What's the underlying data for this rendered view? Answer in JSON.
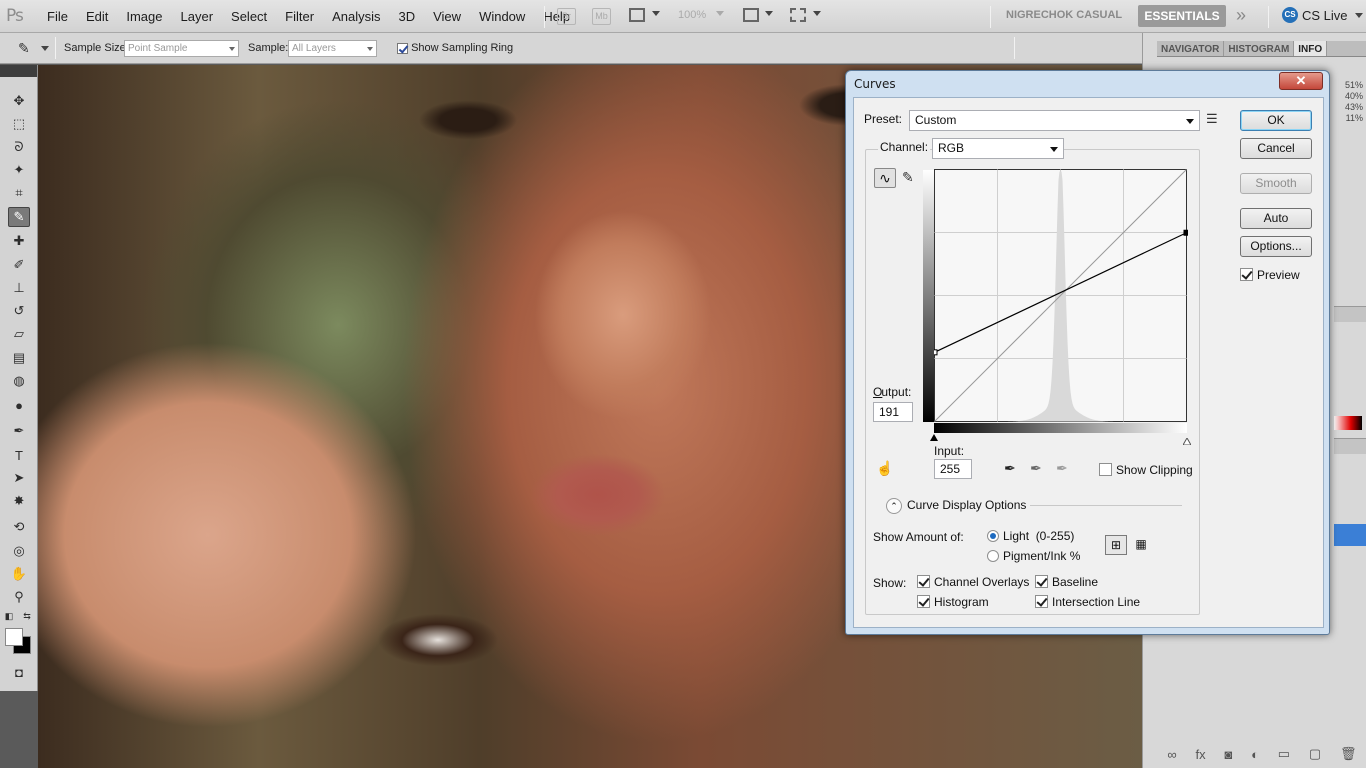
{
  "app": {
    "logo": "Ps"
  },
  "menu": [
    "File",
    "Edit",
    "Image",
    "Layer",
    "Select",
    "Filter",
    "Analysis",
    "3D",
    "View",
    "Window",
    "Help"
  ],
  "menubar": {
    "bridge": "Br",
    "minibridge": "Mb",
    "zoom": "100%",
    "workspace_inactive": "NIGRECHOK CASUAL",
    "workspace_active": "ESSENTIALS",
    "more": "»",
    "cs_live": "CS Live",
    "cs_live_icon": "CS"
  },
  "options_bar": {
    "tool_icon": "eyedropper-icon",
    "sample_size_label": "Sample Size:",
    "sample_size_value": "Point Sample",
    "sample_label": "Sample:",
    "sample_value": "All Layers",
    "show_ring_label": "Show Sampling Ring",
    "show_ring_checked": true
  },
  "panels": {
    "tabs": [
      "NAVIGATOR",
      "HISTOGRAM",
      "INFO"
    ],
    "active_tab": "INFO",
    "info_values": [
      "51%",
      "40%",
      "43%",
      "11%"
    ]
  },
  "curves": {
    "title": "Curves",
    "preset_label": "Preset:",
    "preset_value": "Custom",
    "channel_label": "Channel:",
    "channel_value": "RGB",
    "output_label": "Output:",
    "output_value": "191",
    "input_label": "Input:",
    "input_value": "255",
    "show_clipping": "Show Clipping",
    "show_clipping_checked": false,
    "curve_display_options": "Curve Display Options",
    "show_amount_label": "Show Amount of:",
    "light_option": "Light  (0-255)",
    "pigment_option": "Pigment/Ink %",
    "show_label": "Show:",
    "channel_overlays": "Channel Overlays",
    "baseline": "Baseline",
    "histogram": "Histogram",
    "intersection_line": "Intersection Line",
    "buttons": {
      "ok": "OK",
      "cancel": "Cancel",
      "smooth": "Smooth",
      "auto": "Auto",
      "options": "Options..."
    },
    "preview_label": "Preview",
    "preview_checked": true,
    "curve_points": [
      [
        0,
        70
      ],
      [
        255,
        191
      ]
    ],
    "close_icon": "close-icon"
  },
  "colors": {
    "dialog_frame": "#cfe0f1",
    "dialog_body": "#f0f0f0",
    "accent": "#3c7fb1",
    "workspace_active_bg": "#9a9a9a"
  }
}
